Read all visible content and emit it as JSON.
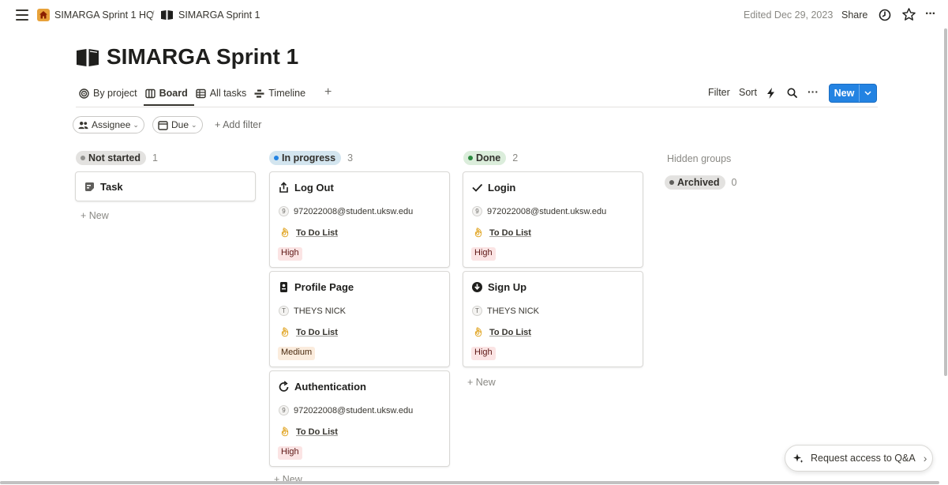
{
  "topbar": {
    "breadcrumb_1": "SIMARGA Sprint 1 HQ",
    "separator": "/",
    "breadcrumb_2": "SIMARGA Sprint 1",
    "edited": "Edited Dec 29, 2023",
    "share": "Share",
    "more": "···"
  },
  "page": {
    "title": "SIMARGA Sprint 1"
  },
  "tabs": [
    {
      "label": "By project",
      "icon": "target-icon"
    },
    {
      "label": "Board",
      "icon": "board-icon",
      "active": true
    },
    {
      "label": "All tasks",
      "icon": "table-icon"
    },
    {
      "label": "Timeline",
      "icon": "timeline-icon"
    }
  ],
  "add_view": "+",
  "toolbar": {
    "filter": "Filter",
    "sort": "Sort",
    "more": "···",
    "new_label": "New",
    "accent": "#2383e2"
  },
  "filters": {
    "assignee": "Assignee",
    "due": "Due",
    "add_filter": "+ Add filter"
  },
  "columns": [
    {
      "status": "Not started",
      "count": "1",
      "color": "#e3e2e0",
      "dot": "#91918e",
      "cards": [
        {
          "title": "Task"
        }
      ],
      "new_label": "+ New"
    },
    {
      "status": "In progress",
      "count": "3",
      "color": "#d3e5ef",
      "dot": "#2383e2",
      "cards": [
        {
          "title": "Log Out",
          "avatar": "9",
          "person": "972022008@student.uksw.edu",
          "project": "To Do List",
          "priority": "High"
        },
        {
          "title": "Profile Page",
          "avatar": "T",
          "person": "THEYS NICK",
          "project": "To Do List",
          "priority": "Medium"
        },
        {
          "title": "Authentication",
          "avatar": "9",
          "person": "972022008@student.uksw.edu",
          "project": "To Do List",
          "priority": "High"
        }
      ],
      "new_label": "+ New"
    },
    {
      "status": "Done",
      "count": "2",
      "color": "#dbeddb",
      "dot": "#2a8a3e",
      "cards": [
        {
          "title": "Login",
          "avatar": "9",
          "person": "972022008@student.uksw.edu",
          "project": "To Do List",
          "priority": "High"
        },
        {
          "title": "Sign Up",
          "avatar": "T",
          "person": "THEYS NICK",
          "project": "To Do List",
          "priority": "High"
        }
      ],
      "new_label": "+ New"
    }
  ],
  "hidden": {
    "label": "Hidden groups",
    "archived": "Archived",
    "archived_count": "0"
  },
  "request_access": "Request access to Q&A"
}
